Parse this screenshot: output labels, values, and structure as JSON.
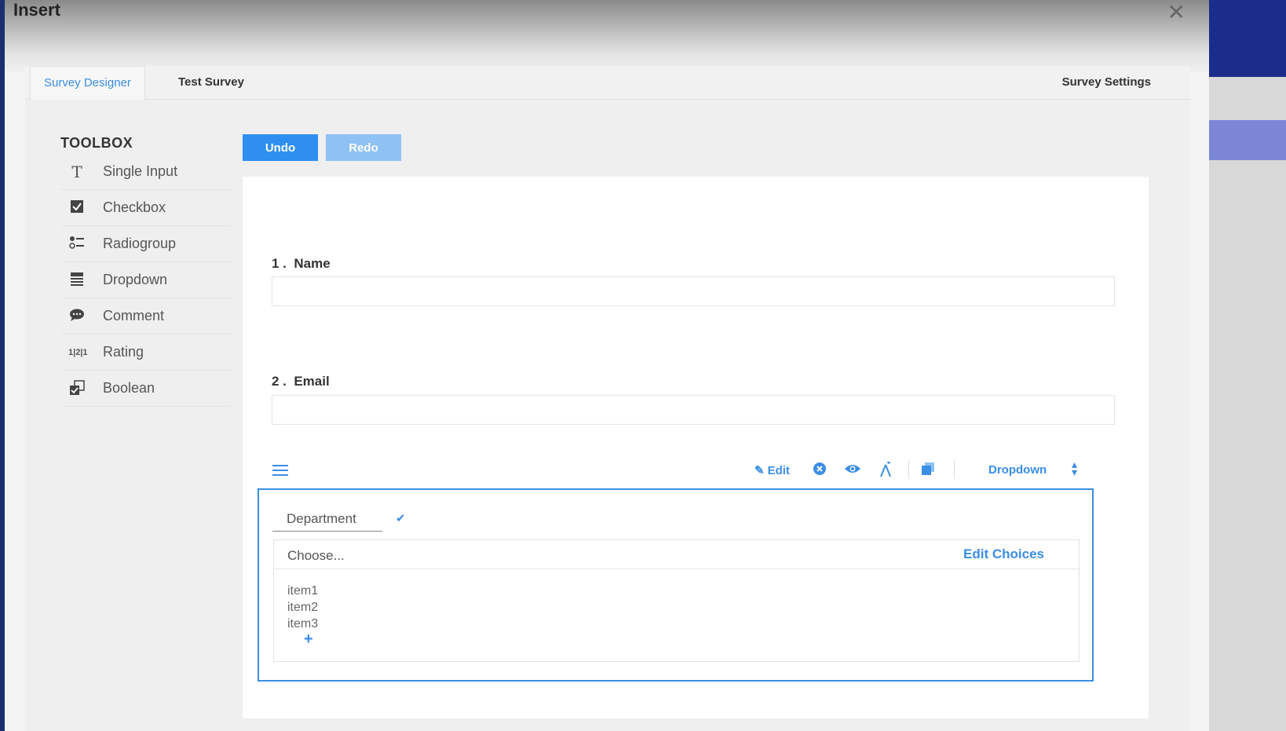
{
  "window": {
    "title": "Insert",
    "close_icon": "close-icon"
  },
  "tabs": [
    {
      "label": "Survey Designer",
      "active": true
    },
    {
      "label": "Test Survey",
      "active": false
    }
  ],
  "settings_label": "Survey Settings",
  "toolbox": {
    "title": "TOOLBOX",
    "items": [
      {
        "label": "Single Input",
        "icon": "text-icon"
      },
      {
        "label": "Checkbox",
        "icon": "checkbox-icon"
      },
      {
        "label": "Radiogroup",
        "icon": "radiogroup-icon"
      },
      {
        "label": "Dropdown",
        "icon": "dropdown-icon"
      },
      {
        "label": "Comment",
        "icon": "comment-icon"
      },
      {
        "label": "Rating",
        "icon": "rating-icon"
      },
      {
        "label": "Boolean",
        "icon": "boolean-icon"
      }
    ]
  },
  "actions": {
    "undo": "Undo",
    "redo": "Redo"
  },
  "questions": [
    {
      "title": "1 .  Name",
      "value": ""
    },
    {
      "title": "2 .  Email",
      "value": ""
    }
  ],
  "question_toolbar": {
    "edit_label": "Edit",
    "type_label": "Dropdown"
  },
  "selected_question": {
    "title": "Department",
    "placeholder": "Choose...",
    "edit_choices_label": "Edit Choices",
    "items": [
      "item1",
      "item2",
      "item3"
    ]
  },
  "colors": {
    "accent": "#3a8ee6",
    "undo": "#2f8ff0",
    "redo": "#8ec1f4"
  }
}
